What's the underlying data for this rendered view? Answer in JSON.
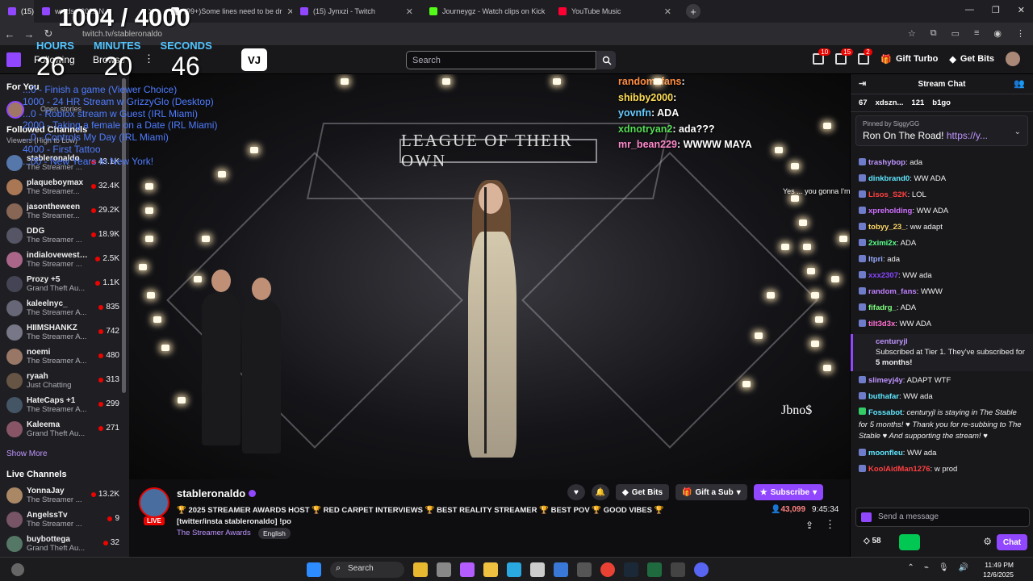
{
  "browser": {
    "tabs": [
      {
        "label": "(15) stablero",
        "color": "#9147ff",
        "active": true
      },
      {
        "label": "wards - 2025 N",
        "color": "#9147ff",
        "active": false
      },
      {
        "label": "(99+)Some lines need to be dr",
        "color": "#ffffff",
        "active": false
      },
      {
        "label": "(15) Jynxzi - Twitch",
        "color": "#9147ff",
        "active": false
      },
      {
        "label": "Journeygz - Watch clips on Kick",
        "color": "#53fc18",
        "active": false
      },
      {
        "label": "YouTube Music",
        "color": "#ff0033",
        "active": false
      }
    ],
    "url": "twitch.tv/stableronaldo"
  },
  "overlay": {
    "counter": "1004 / 4000",
    "labels": {
      "hours": "HOURS",
      "minutes": "MINUTES",
      "seconds": "SECONDS"
    },
    "values": {
      "hours": "26",
      "minutes": "20",
      "seconds": "46"
    },
    "goals": [
      "...0 - Finish a game (Viewer Choice)",
      "1000 - 24 HR Stream w GrizzyGlo (Desktop)",
      "...0 - Roblox stream w Guest (IRL Miami)",
      "2000 - Taking a female on a Date (IRL Miami)",
      "...0 - Controls My Day (IRL Miami)",
      "4000 - First Tattoo",
      "...00 - New Years In New York!"
    ]
  },
  "topbar": {
    "following": "Following",
    "browse": "Browse",
    "vj_label": "VJ",
    "search_placeholder": "Search",
    "badge_inbox": "10",
    "badge_whispers": "15",
    "badge_notifications": "2",
    "gift_turbo": "Gift Turbo",
    "get_bits": "Get Bits"
  },
  "sidebar": {
    "for_you": "For You",
    "open_stories": "Open stories",
    "followed_heading": "Followed Channels",
    "followed_sub": "Viewers (High to Low)",
    "followed": [
      {
        "name": "stableronaldo",
        "cat": "The Streamer ...",
        "viewers": "43.1K",
        "color": "#5577aa"
      },
      {
        "name": "plaqueboymax",
        "cat": "The Streamer...",
        "viewers": "32.4K",
        "color": "#aa7755"
      },
      {
        "name": "jasontheween",
        "cat": "The Streamer...",
        "viewers": "29.2K",
        "color": "#886655"
      },
      {
        "name": "DDG",
        "cat": "The Streamer ...",
        "viewers": "18.9K",
        "color": "#555566"
      },
      {
        "name": "indialovewestb...",
        "cat": "The Streamer ...",
        "viewers": "2.5K",
        "color": "#aa6688"
      },
      {
        "name": "Prozy +5",
        "cat": "Grand Theft Au...",
        "viewers": "1.1K",
        "color": "#444455"
      },
      {
        "name": "kaleelnyc_",
        "cat": "The Streamer A...",
        "viewers": "835",
        "color": "#666677"
      },
      {
        "name": "HIIMSHANKZ",
        "cat": "The Streamer A...",
        "viewers": "742",
        "color": "#777788"
      },
      {
        "name": "noemi",
        "cat": "The Streamer A...",
        "viewers": "480",
        "color": "#997766"
      },
      {
        "name": "ryaah",
        "cat": "Just Chatting",
        "viewers": "313",
        "color": "#665544"
      },
      {
        "name": "HateCaps +1",
        "cat": "The Streamer A...",
        "viewers": "299",
        "color": "#445566"
      },
      {
        "name": "Kaleema",
        "cat": "Grand Theft Au...",
        "viewers": "271",
        "color": "#885566"
      }
    ],
    "show_more": "Show More",
    "live_heading": "Live Channels",
    "live": [
      {
        "name": "YonnaJay",
        "cat": "The Streamer ...",
        "viewers": "13.2K",
        "color": "#aa8866"
      },
      {
        "name": "AngelssTv",
        "cat": "The Streamer ...",
        "viewers": "9",
        "color": "#775566"
      },
      {
        "name": "buybottega",
        "cat": "Grand Theft Au...",
        "viewers": "32",
        "color": "#557766"
      }
    ]
  },
  "video": {
    "banner": "LEAGUE OF THEIR OWN",
    "watermark": "Jbno$",
    "floating_message": "Yes ... you gonna I'm learning how to make a bomb",
    "overlay_chat": [
      {
        "user": "random_fans",
        "msg": "",
        "color": "#ff8c42"
      },
      {
        "user": "shibby2000",
        "msg": "",
        "color": "#ffdd55"
      },
      {
        "user": "yovnfn",
        "msg": "ADA",
        "color": "#66ccff"
      },
      {
        "user": "xdnotryan2",
        "msg": "ada???",
        "color": "#55dd55"
      },
      {
        "user": "mr_bean229",
        "msg": "WWWW MAYA",
        "color": "#ff88cc"
      }
    ]
  },
  "info": {
    "streamer": "stableronaldo",
    "live": "LIVE",
    "title": "🏆 2025 STREAMER AWARDS HOST 🏆 RED CARPET INTERVIEWS 🏆 BEST REALITY STREAMER 🏆 BEST POV 🏆 GOOD VIBES 🏆 [twitter/insta stableronaldo] !po",
    "category": "The Streamer Awards",
    "language": "English",
    "get_bits": "Get Bits",
    "gift_sub": "Gift a Sub",
    "subscribe": "Subscribe",
    "viewers": "43,099",
    "uptime": "9:45:34"
  },
  "chat": {
    "title": "Stream Chat",
    "leaderboard": [
      "67",
      "xdszn...",
      "121",
      "b1go"
    ],
    "pinned_by": "Pinned by SiggyGG",
    "pinned_msg": "Ron On The Road!",
    "pinned_link": "https://y...",
    "messages": [
      {
        "user": "trashybop",
        "msg": "ada",
        "color": "#bf94ff"
      },
      {
        "user": "dinkbrand0",
        "msg": "WW ADA",
        "color": "#5ee8ff"
      },
      {
        "user": "Lisos_S2K",
        "msg": "LOL",
        "color": "#ff4040"
      },
      {
        "user": "xpreholding",
        "msg": "WW ADA",
        "color": "#d070ff"
      },
      {
        "user": "tobyy_23_",
        "msg": "ww adapt",
        "color": "#ffd966"
      },
      {
        "user": "2ximi2x",
        "msg": "ADA",
        "color": "#58ff8a"
      },
      {
        "user": "ltpri",
        "msg": "ada",
        "color": "#9aaaff"
      },
      {
        "user": "xxx2307",
        "msg": "WW ada",
        "color": "#8844ff"
      },
      {
        "user": "random_fans",
        "msg": "WWW",
        "color": "#c080ff"
      },
      {
        "user": "fifadrg_",
        "msg": "ADA",
        "color": "#7dff7d"
      },
      {
        "user": "tilt3d3x",
        "msg": "WW ADA",
        "color": "#ff6fcf"
      }
    ],
    "sub_user": "centuryjl",
    "sub_line1": "Subscribed at Tier 1. They've subscribed for",
    "sub_months": "5 months!",
    "after_sub": [
      {
        "user": "slimeyj4y",
        "msg": "ADAPT WTF",
        "color": "#bf94ff"
      },
      {
        "user": "buthafar",
        "msg": "WW ada",
        "color": "#5ee8ff"
      }
    ],
    "bot_user": "Fossabot",
    "bot_msg": "centuryjl is staying in The Stable for 5 months! ♥ Thank you for re-subbing to The Stable ♥ And supporting the stream! ♥",
    "tail": [
      {
        "user": "moonfleu",
        "msg": "WW ada",
        "color": "#5ee8ff"
      },
      {
        "user": "KoolAidMan1276",
        "msg": "w prod",
        "color": "#ff4040"
      }
    ],
    "placeholder": "Send a message",
    "points": "58",
    "chat_button": "Chat"
  },
  "taskbar": {
    "search": "Search",
    "time": "11:49 PM",
    "date": "12/6/2025"
  }
}
